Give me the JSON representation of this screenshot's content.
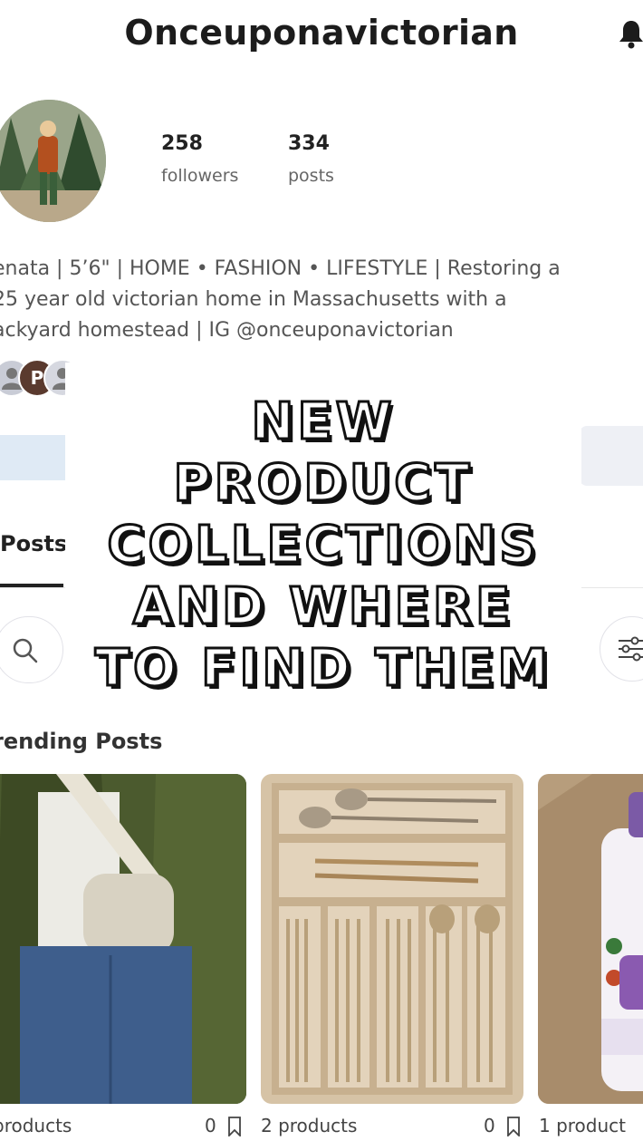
{
  "header": {
    "title": "Onceuponavictorian"
  },
  "profile": {
    "followers_count": "258",
    "followers_label": "followers",
    "posts_count": "334",
    "posts_label": "posts",
    "bio_lines": [
      "enata | 5’6\" | HOME • FASHION • LIFESTYLE | Restoring a",
      "25 year old victorian home in Massachusetts with a",
      "ackyard homestead | IG @onceuponavictorian"
    ],
    "mini_avatar_letter": "P"
  },
  "tabs": {
    "active": "Posts"
  },
  "overlay": {
    "lines": [
      "NEW",
      "PRODUCT",
      "COLLECTIONS",
      "AND WHERE",
      "TO FIND THEM"
    ]
  },
  "section": {
    "title": "rending Posts"
  },
  "cards": [
    {
      "products": "products",
      "saves": "0"
    },
    {
      "products": "2 products",
      "saves": "0"
    },
    {
      "products": "1 product"
    }
  ],
  "icons": {
    "bell": "bell-icon",
    "search": "search-icon",
    "filter": "filter-sliders-icon",
    "bookmark": "bookmark-icon"
  },
  "colors": {
    "follow_button": "#dfeaf5",
    "overlay_text_fill": "#ffffff",
    "overlay_text_stroke": "#111111"
  }
}
